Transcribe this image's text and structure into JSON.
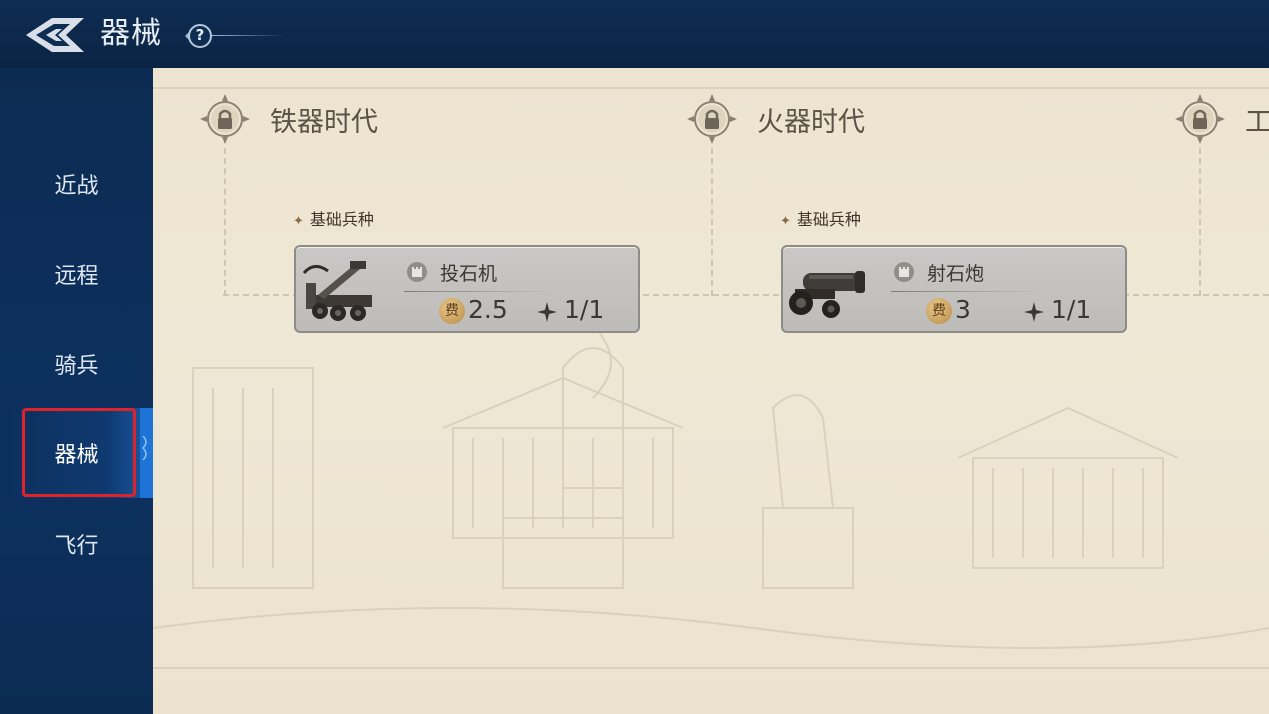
{
  "header": {
    "title": "器械",
    "back_icon": "back-arrow-logo-icon",
    "help_icon": "question-mark-icon",
    "help_glyph": "?"
  },
  "sidebar": {
    "items": [
      {
        "label": "近战",
        "active": false
      },
      {
        "label": "远程",
        "active": false
      },
      {
        "label": "骑兵",
        "active": false
      },
      {
        "label": "器械",
        "active": true
      },
      {
        "label": "飞行",
        "active": false
      }
    ]
  },
  "eras": [
    {
      "title": "铁器时代",
      "locked": true,
      "group_label": "基础兵种",
      "unit": {
        "name": "投石机",
        "cost": "2.5",
        "count": "1/1",
        "image": "catapult-image",
        "cost_glyph": "费"
      }
    },
    {
      "title": "火器时代",
      "locked": true,
      "group_label": "基础兵种",
      "unit": {
        "name": "射石炮",
        "cost": "3",
        "count": "1/1",
        "image": "cannon-image",
        "cost_glyph": "费"
      }
    },
    {
      "title": "工",
      "locked": true
    }
  ],
  "colors": {
    "header_bg": "#0e2d53",
    "sidebar_bg": "#0b2b52",
    "active_edge": "#1d74d6",
    "highlight_border": "#e0222a",
    "panel_bg": "#ece4cf",
    "card_bg": "#c9c8c6"
  }
}
